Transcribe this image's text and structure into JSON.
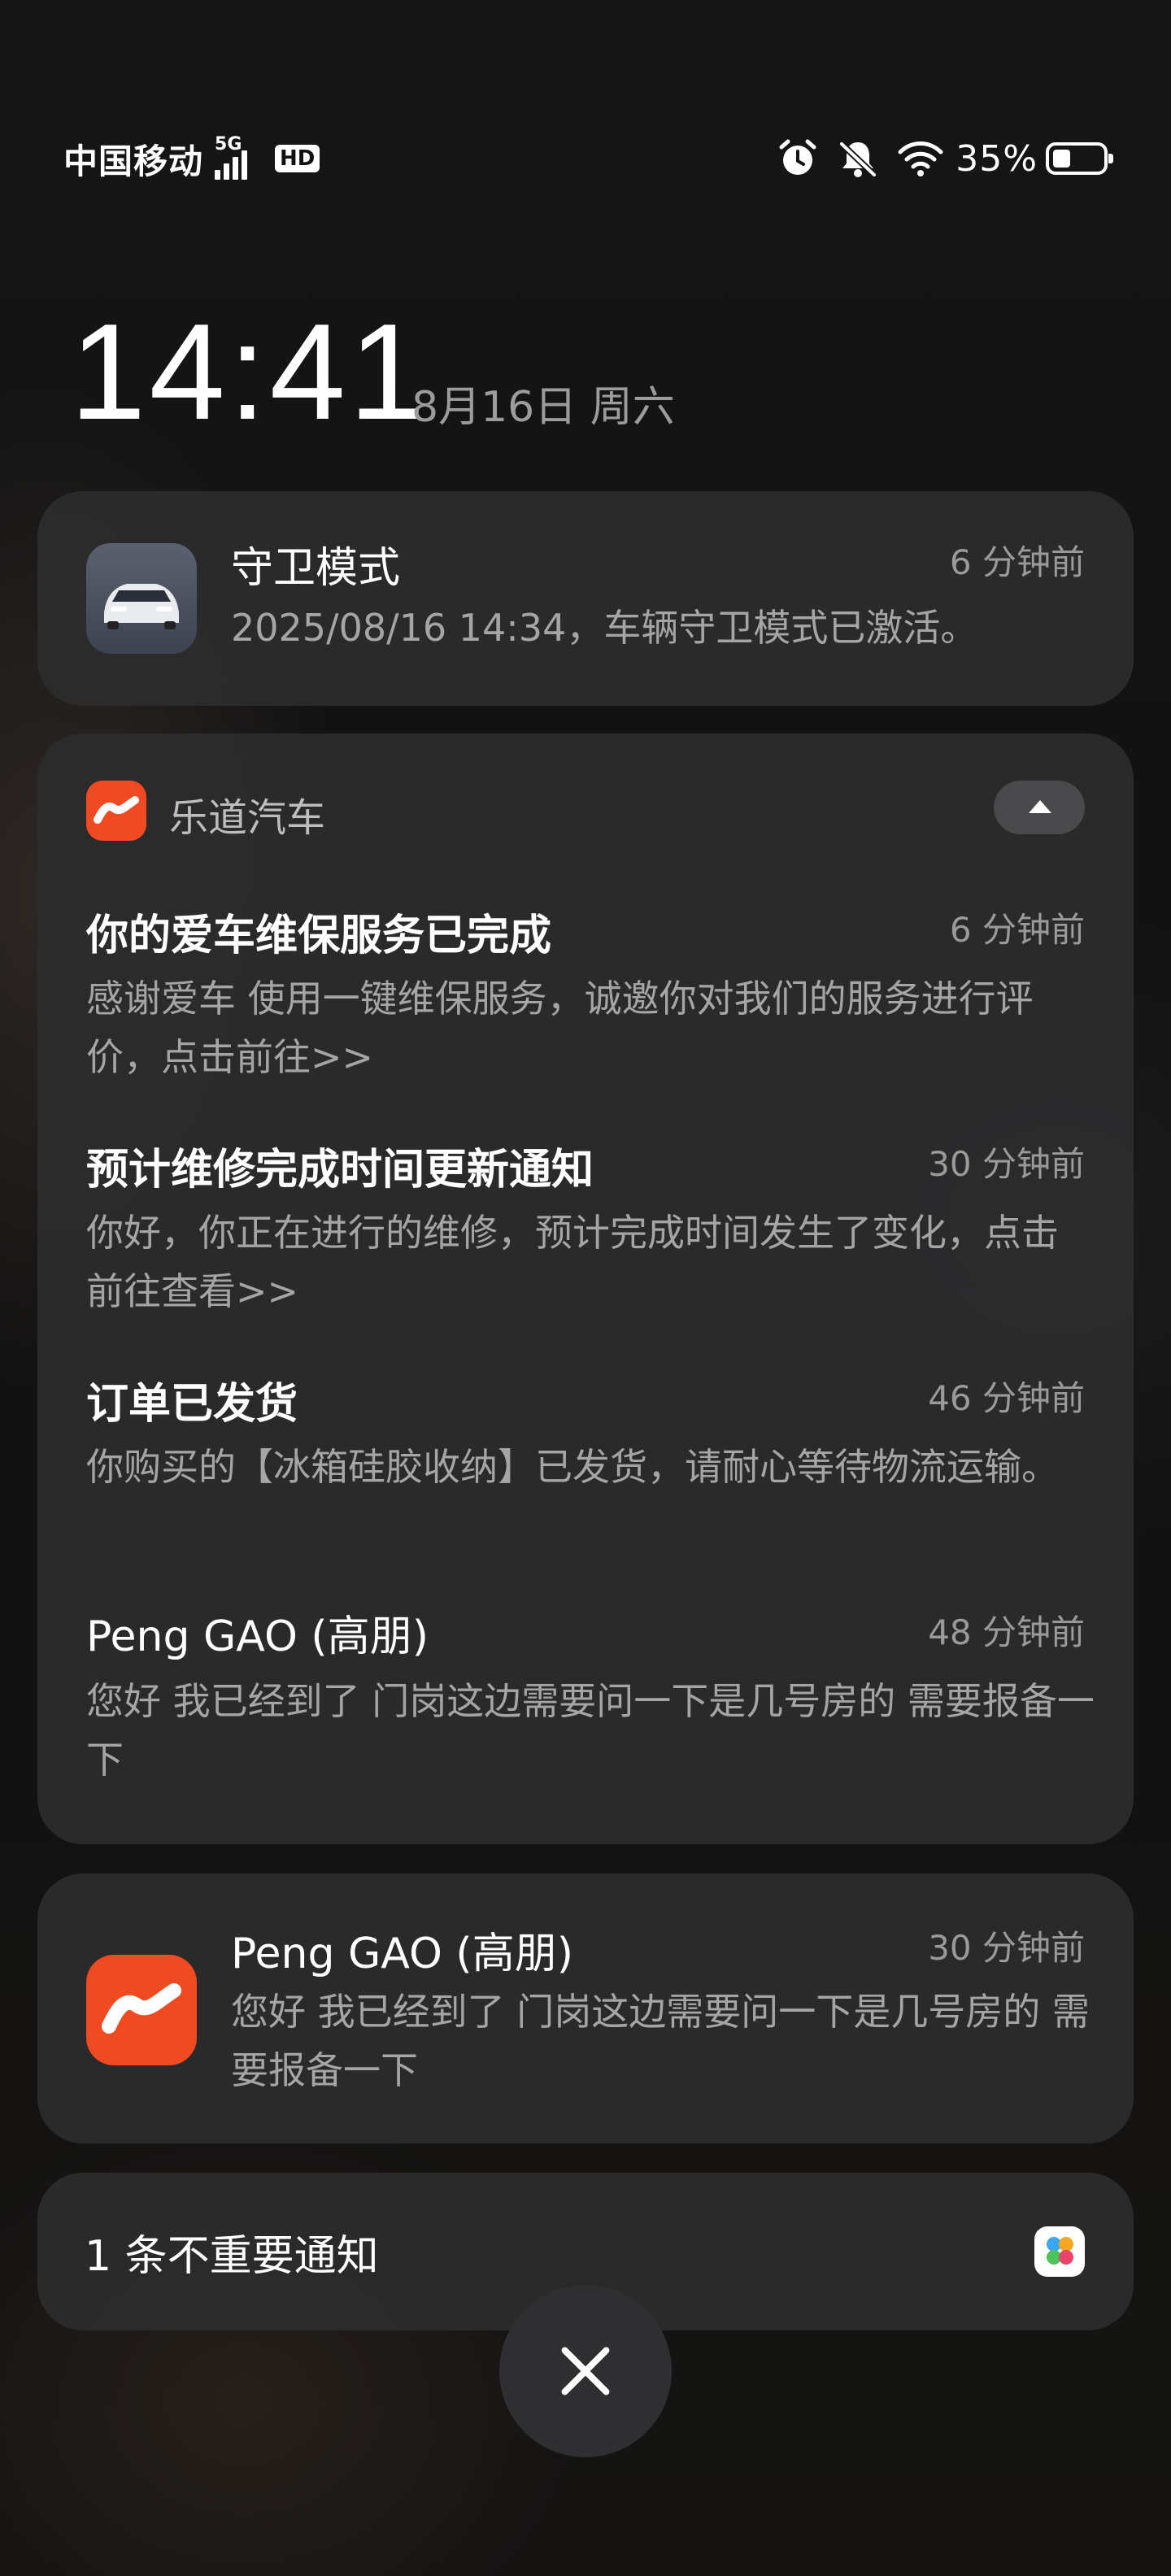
{
  "status_bar": {
    "carrier": "中国移动",
    "network": "5G",
    "hd": "HD",
    "battery_percent": "35%",
    "battery_level": 0.35,
    "icons": [
      "alarm-icon",
      "mute-icon",
      "wifi-icon",
      "battery-icon"
    ]
  },
  "lock": {
    "time": "14:41",
    "date": "8月16日 周六"
  },
  "guard_notification": {
    "title": "守卫模式",
    "time": "6 分钟前",
    "body": "2025/08/16 14:34，车辆守卫模式已激活。"
  },
  "app_group": {
    "app_name": "乐道汽车",
    "brand_color": "#f04a22",
    "items": [
      {
        "title": "你的爱车维保服务已完成",
        "time": "6 分钟前",
        "body": "感谢爱车 使用一键维保服务，诚邀你对我们的服务进行评价，点击前往>>"
      },
      {
        "title": "预计维修完成时间更新通知",
        "time": "30 分钟前",
        "body": "你好，你正在进行的维修，预计完成时间发生了变化，点击前往查看>>"
      },
      {
        "title": "订单已发货",
        "time": "46 分钟前",
        "body": "你购买的【冰箱硅胶收纳】已发货，请耐心等待物流运输。"
      },
      {
        "title": "Peng GAO (高朋)",
        "time": "48 分钟前",
        "body": "您好  我已经到了  门岗这边需要问一下是几号房的  需要报备一下"
      }
    ]
  },
  "peng_notification": {
    "title": "Peng GAO (高朋)",
    "time": "30 分钟前",
    "body": "您好  我已经到了  门岗这边需要问一下是几号房的  需要报备一下"
  },
  "unimportant": {
    "label": "1 条不重要通知"
  }
}
